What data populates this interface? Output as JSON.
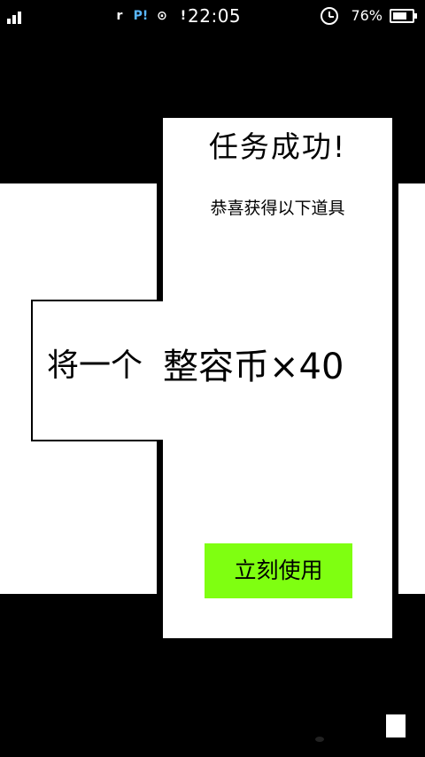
{
  "status_bar": {
    "time": "22:05",
    "battery_percent": "76%",
    "battery_level": 0.76,
    "app_icons": [
      "r",
      "P!",
      "⊙",
      "!"
    ]
  },
  "background": {
    "task_text": "将一个"
  },
  "dialog": {
    "title": "任务成功!",
    "subtitle": "恭喜获得以下道具",
    "reward": "整容币×40",
    "button_label": "立刻使用",
    "button_color": "#7fff11"
  }
}
